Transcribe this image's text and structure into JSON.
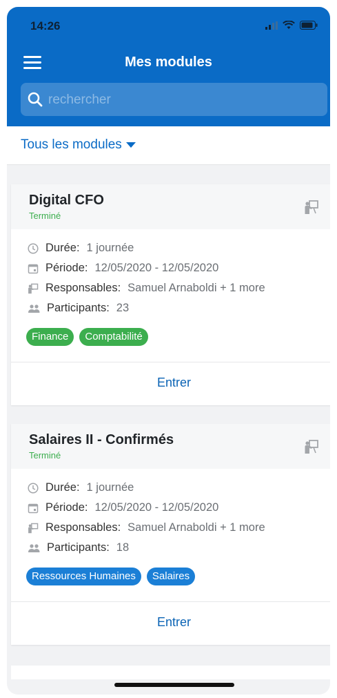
{
  "status_bar": {
    "time": "14:26"
  },
  "header": {
    "title": "Mes modules"
  },
  "search": {
    "placeholder": "rechercher"
  },
  "filter": {
    "label": "Tous les modules"
  },
  "colors": {
    "brand": "#0a6bc6",
    "status_done": "#3cae4e",
    "tag_green": "#3cae4e",
    "tag_blue": "#1b7fd6"
  },
  "labels": {
    "duree": "Durée:",
    "periode": "Période:",
    "responsables": "Responsables:",
    "participants": "Participants:",
    "enter": "Entrer"
  },
  "modules": [
    {
      "title": "Digital CFO",
      "status": "Terminé",
      "duree": "1 journée",
      "periode": "12/05/2020 - 12/05/2020",
      "responsables": "Samuel Arnaboldi + 1 more",
      "participants": "23",
      "tags": [
        "Finance",
        "Comptabilité"
      ]
    },
    {
      "title": "Salaires II - Confirmés",
      "status": "Terminé",
      "duree": "1 journée",
      "periode": "12/05/2020 - 12/05/2020",
      "responsables": "Samuel Arnaboldi + 1 more",
      "participants": "18",
      "tags": [
        "Ressources Humaines",
        "Salaires"
      ]
    }
  ]
}
